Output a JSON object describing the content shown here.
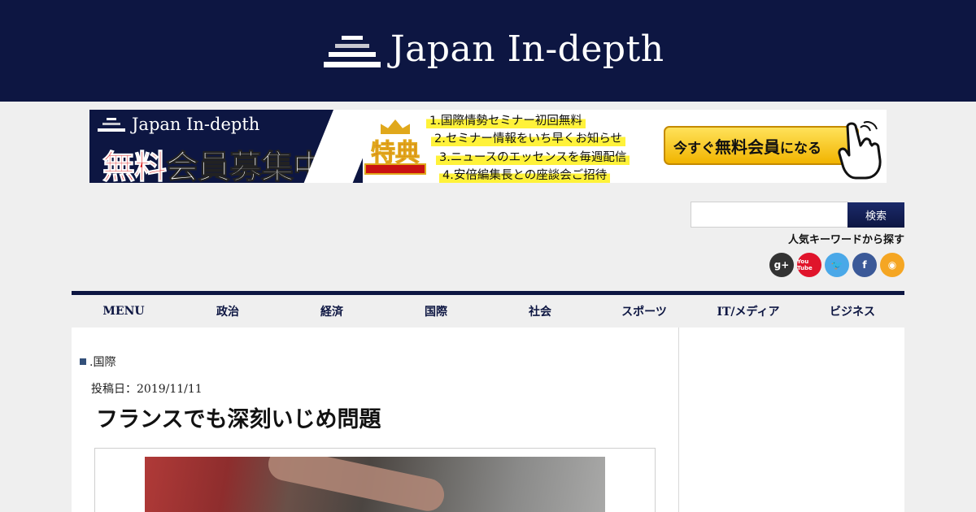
{
  "header": {
    "site_name": "Japan In-depth"
  },
  "banner": {
    "logo_text": "Japan In-depth",
    "recruit_red": "無料",
    "recruit_white": "会員募集中",
    "tokuten": "特典",
    "benefits": [
      "1.国際情勢セミナー初回無料",
      "2.セミナー情報をいち早くお知らせ",
      "3.ニュースのエッセンスを毎週配信",
      "4.安倍編集長との座談会ご招待"
    ],
    "cta_pre": "今すぐ",
    "cta_main": "無料会員",
    "cta_post": "になる"
  },
  "search": {
    "button_label": "検索",
    "value": "",
    "popular_label": "人気キーワードから探す"
  },
  "social": [
    {
      "name": "google-plus",
      "glyph": "g+"
    },
    {
      "name": "youtube",
      "glyph": "You Tube"
    },
    {
      "name": "twitter",
      "glyph": "🐦"
    },
    {
      "name": "facebook",
      "glyph": "f"
    },
    {
      "name": "rss",
      "glyph": "◉"
    }
  ],
  "nav": [
    "MENU",
    "政治",
    "経済",
    "国際",
    "社会",
    "スポーツ",
    "IT/メディア",
    "ビジネス"
  ],
  "article": {
    "category": ".国際",
    "posted": "投稿日：2019/11/11",
    "title": "フランスでも深刻いじめ問題"
  },
  "colors": {
    "navy": "#0d1642",
    "background": "#efefef",
    "highlight": "#fff23a",
    "cta": "#f1b400"
  }
}
